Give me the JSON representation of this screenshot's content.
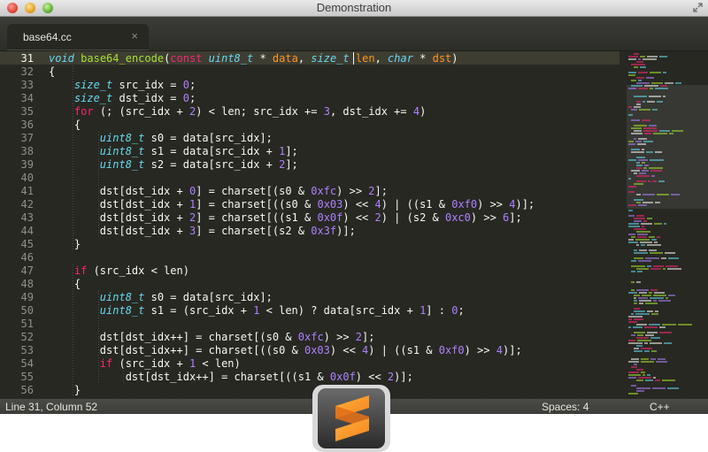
{
  "window": {
    "title": "Demonstration"
  },
  "tabs": [
    {
      "label": "base64.cc",
      "close": "×"
    }
  ],
  "editor": {
    "current_line_index": 0,
    "lines": [
      {
        "num": "31",
        "tokens": [
          [
            "ty",
            "void"
          ],
          [
            "p",
            " "
          ],
          [
            "fn",
            "base64_encode"
          ],
          [
            "p",
            "("
          ],
          [
            "kw",
            "const"
          ],
          [
            "p",
            " "
          ],
          [
            "ty",
            "uint8_t"
          ],
          [
            "p",
            " * "
          ],
          [
            "param",
            "data"
          ],
          [
            "p",
            ", "
          ],
          [
            "ty",
            "size_t"
          ],
          [
            "p",
            " "
          ],
          [
            "param",
            "len"
          ],
          [
            "p",
            ", "
          ],
          [
            "ty",
            "char"
          ],
          [
            "p",
            " * "
          ],
          [
            "param",
            "dst"
          ],
          [
            "p",
            ")"
          ]
        ]
      },
      {
        "num": "32",
        "tokens": [
          [
            "p",
            "{"
          ]
        ]
      },
      {
        "num": "33",
        "tokens": [
          [
            "p",
            "    "
          ],
          [
            "ty",
            "size_t"
          ],
          [
            "p",
            " src_idx = "
          ],
          [
            "num",
            "0"
          ],
          [
            "p",
            ";"
          ]
        ]
      },
      {
        "num": "34",
        "tokens": [
          [
            "p",
            "    "
          ],
          [
            "ty",
            "size_t"
          ],
          [
            "p",
            " dst_idx = "
          ],
          [
            "num",
            "0"
          ],
          [
            "p",
            ";"
          ]
        ]
      },
      {
        "num": "35",
        "tokens": [
          [
            "p",
            "    "
          ],
          [
            "kw",
            "for"
          ],
          [
            "p",
            " (; (src_idx + "
          ],
          [
            "num",
            "2"
          ],
          [
            "p",
            ") < len; src_idx += "
          ],
          [
            "num",
            "3"
          ],
          [
            "p",
            ", dst_idx += "
          ],
          [
            "num",
            "4"
          ],
          [
            "p",
            ")"
          ]
        ]
      },
      {
        "num": "36",
        "tokens": [
          [
            "p",
            "    {"
          ]
        ]
      },
      {
        "num": "37",
        "tokens": [
          [
            "p",
            "        "
          ],
          [
            "ty",
            "uint8_t"
          ],
          [
            "p",
            " s0 = data[src_idx];"
          ]
        ]
      },
      {
        "num": "38",
        "tokens": [
          [
            "p",
            "        "
          ],
          [
            "ty",
            "uint8_t"
          ],
          [
            "p",
            " s1 = data[src_idx + "
          ],
          [
            "num",
            "1"
          ],
          [
            "p",
            "];"
          ]
        ]
      },
      {
        "num": "39",
        "tokens": [
          [
            "p",
            "        "
          ],
          [
            "ty",
            "uint8_t"
          ],
          [
            "p",
            " s2 = data[src_idx + "
          ],
          [
            "num",
            "2"
          ],
          [
            "p",
            "];"
          ]
        ]
      },
      {
        "num": "40",
        "tokens": []
      },
      {
        "num": "41",
        "tokens": [
          [
            "p",
            "        dst[dst_idx + "
          ],
          [
            "num",
            "0"
          ],
          [
            "p",
            "] = charset[(s0 & "
          ],
          [
            "num",
            "0xfc"
          ],
          [
            "p",
            ") >> "
          ],
          [
            "num",
            "2"
          ],
          [
            "p",
            "];"
          ]
        ]
      },
      {
        "num": "42",
        "tokens": [
          [
            "p",
            "        dst[dst_idx + "
          ],
          [
            "num",
            "1"
          ],
          [
            "p",
            "] = charset[((s0 & "
          ],
          [
            "num",
            "0x03"
          ],
          [
            "p",
            ") << "
          ],
          [
            "num",
            "4"
          ],
          [
            "p",
            ") | ((s1 & "
          ],
          [
            "num",
            "0xf0"
          ],
          [
            "p",
            ") >> "
          ],
          [
            "num",
            "4"
          ],
          [
            "p",
            ")];"
          ]
        ]
      },
      {
        "num": "43",
        "tokens": [
          [
            "p",
            "        dst[dst_idx + "
          ],
          [
            "num",
            "2"
          ],
          [
            "p",
            "] = charset[((s1 & "
          ],
          [
            "num",
            "0x0f"
          ],
          [
            "p",
            ") << "
          ],
          [
            "num",
            "2"
          ],
          [
            "p",
            ") | (s2 & "
          ],
          [
            "num",
            "0xc0"
          ],
          [
            "p",
            ") >> "
          ],
          [
            "num",
            "6"
          ],
          [
            "p",
            "];"
          ]
        ]
      },
      {
        "num": "44",
        "tokens": [
          [
            "p",
            "        dst[dst_idx + "
          ],
          [
            "num",
            "3"
          ],
          [
            "p",
            "] = charset[(s2 & "
          ],
          [
            "num",
            "0x3f"
          ],
          [
            "p",
            ")];"
          ]
        ]
      },
      {
        "num": "45",
        "tokens": [
          [
            "p",
            "    }"
          ]
        ]
      },
      {
        "num": "46",
        "tokens": []
      },
      {
        "num": "47",
        "tokens": [
          [
            "p",
            "    "
          ],
          [
            "kw",
            "if"
          ],
          [
            "p",
            " (src_idx < len)"
          ]
        ]
      },
      {
        "num": "48",
        "tokens": [
          [
            "p",
            "    {"
          ]
        ]
      },
      {
        "num": "49",
        "tokens": [
          [
            "p",
            "        "
          ],
          [
            "ty",
            "uint8_t"
          ],
          [
            "p",
            " s0 = data[src_idx];"
          ]
        ]
      },
      {
        "num": "50",
        "tokens": [
          [
            "p",
            "        "
          ],
          [
            "ty",
            "uint8_t"
          ],
          [
            "p",
            " s1 = (src_idx + "
          ],
          [
            "num",
            "1"
          ],
          [
            "p",
            " < len) ? data[src_idx + "
          ],
          [
            "num",
            "1"
          ],
          [
            "p",
            "] : "
          ],
          [
            "num",
            "0"
          ],
          [
            "p",
            ";"
          ]
        ]
      },
      {
        "num": "51",
        "tokens": []
      },
      {
        "num": "52",
        "tokens": [
          [
            "p",
            "        dst[dst_idx++] = charset[(s0 & "
          ],
          [
            "num",
            "0xfc"
          ],
          [
            "p",
            ") >> "
          ],
          [
            "num",
            "2"
          ],
          [
            "p",
            "];"
          ]
        ]
      },
      {
        "num": "53",
        "tokens": [
          [
            "p",
            "        dst[dst_idx++] = charset[((s0 & "
          ],
          [
            "num",
            "0x03"
          ],
          [
            "p",
            ") << "
          ],
          [
            "num",
            "4"
          ],
          [
            "p",
            ") | ((s1 & "
          ],
          [
            "num",
            "0xf0"
          ],
          [
            "p",
            ") >> "
          ],
          [
            "num",
            "4"
          ],
          [
            "p",
            ")];"
          ]
        ]
      },
      {
        "num": "54",
        "tokens": [
          [
            "p",
            "        "
          ],
          [
            "kw",
            "if"
          ],
          [
            "p",
            " (src_idx + "
          ],
          [
            "num",
            "1"
          ],
          [
            "p",
            " < len)"
          ]
        ]
      },
      {
        "num": "55",
        "tokens": [
          [
            "p",
            "            dst[dst_idx++] = charset[((s1 & "
          ],
          [
            "num",
            "0x0f"
          ],
          [
            "p",
            ") << "
          ],
          [
            "num",
            "2"
          ],
          [
            "p",
            ")];"
          ]
        ]
      },
      {
        "num": "56",
        "tokens": [
          [
            "p",
            "    }"
          ]
        ]
      }
    ]
  },
  "status": {
    "position": "Line 31, Column 52",
    "spaces": "Spaces: 4",
    "syntax": "C++"
  },
  "colors": {
    "background": "#272822",
    "keyword": "#f92672",
    "type": "#66d9ef",
    "function": "#a6e22e",
    "number": "#ae81ff",
    "plain": "#f8f8f2"
  },
  "icons": {
    "close": "close-traffic-light-icon",
    "minimize": "minimize-traffic-light-icon",
    "zoom": "zoom-traffic-light-icon",
    "fullscreen": "fullscreen-icon",
    "app_logo": "sublime-text-logo-icon"
  }
}
